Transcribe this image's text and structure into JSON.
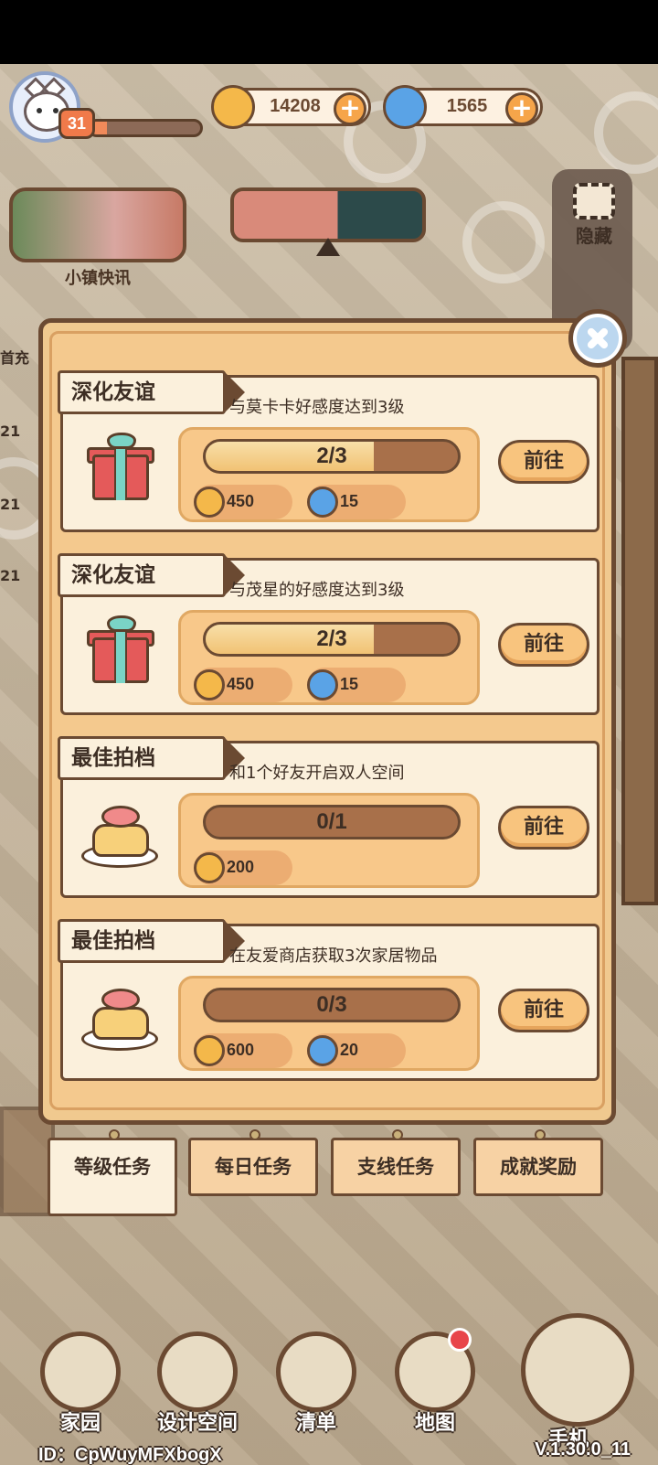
{
  "player": {
    "level": "31",
    "level_progress": 0.15
  },
  "currency": {
    "coins": {
      "value": "14208",
      "icon": "coin-icon"
    },
    "gems": {
      "value": "1565",
      "icon": "swirl-gem-icon"
    }
  },
  "town_news": {
    "label": "小镇快讯"
  },
  "side": {
    "hide_label": "隐藏"
  },
  "left_stubs": [
    "首充",
    "21",
    "21",
    "21"
  ],
  "tasks": [
    {
      "tag": "深化友谊",
      "desc": "与莫卡卡好感度达到3级",
      "icon": "gift-icon",
      "progress_text": "2/3",
      "progress": 0.667,
      "rewards": [
        {
          "icon": "coin-icon",
          "value": "450"
        },
        {
          "icon": "swirl-gem-icon",
          "value": "15"
        }
      ],
      "button": "前往"
    },
    {
      "tag": "深化友谊",
      "desc": "与茂星的好感度达到3级",
      "icon": "gift-icon",
      "progress_text": "2/3",
      "progress": 0.667,
      "rewards": [
        {
          "icon": "coin-icon",
          "value": "450"
        },
        {
          "icon": "swirl-gem-icon",
          "value": "15"
        }
      ],
      "button": "前往"
    },
    {
      "tag": "最佳拍档",
      "desc": "和1个好友开启双人空间",
      "icon": "cake-icon",
      "progress_text": "0/1",
      "progress": 0,
      "rewards": [
        {
          "icon": "coin-icon",
          "value": "200"
        }
      ],
      "button": "前往"
    },
    {
      "tag": "最佳拍档",
      "desc": "在友爱商店获取3次家居物品",
      "icon": "cake-icon",
      "progress_text": "0/3",
      "progress": 0,
      "rewards": [
        {
          "icon": "coin-icon",
          "value": "600"
        },
        {
          "icon": "swirl-gem-icon",
          "value": "20"
        }
      ],
      "button": "前往"
    }
  ],
  "tabs": [
    {
      "label": "等级任务",
      "active": true
    },
    {
      "label": "每日任务",
      "active": false
    },
    {
      "label": "支线任务",
      "active": false
    },
    {
      "label": "成就奖励",
      "active": false
    }
  ],
  "nav": [
    {
      "label": "家园",
      "icon": "home-icon"
    },
    {
      "label": "设计空间",
      "icon": "design-ruler-icon"
    },
    {
      "label": "清单",
      "icon": "list-quill-icon"
    },
    {
      "label": "地图",
      "icon": "map-pin-icon"
    },
    {
      "label": "手机",
      "icon": "phone-icon"
    }
  ],
  "footer": {
    "id": "ID：CpWuyMFXbogX",
    "version": "V.1.30.0_11"
  },
  "colors": {
    "coin": "#f4b84a",
    "gem": "#5aa3e6",
    "panel": "#f0c98f",
    "card": "#fbf0dc",
    "outline": "#6b4a32"
  }
}
